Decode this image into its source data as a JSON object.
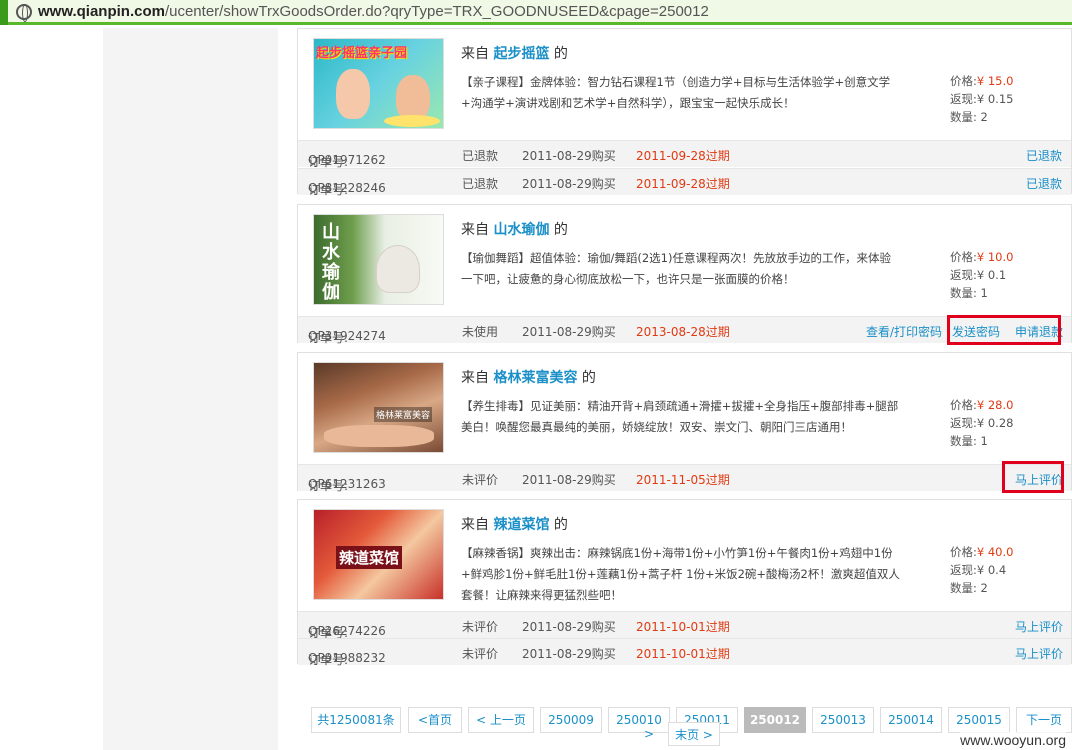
{
  "browser": {
    "url_domain": "www.qianpin.com",
    "url_path": "/ucenter/showTrxGoodsOrder.do?qryType=TRX_GOODNUSEED&cpage=250012"
  },
  "labels": {
    "from_prefix": "来自",
    "from_suffix": "的",
    "price": "价格:",
    "rebate": "返现:",
    "qty": "数量:",
    "order_no": "订单号:"
  },
  "orders": [
    {
      "shop": "起步摇篮",
      "thumb_text": "起步摇篮亲子园",
      "desc": "【亲子课程】金牌体验：智力钻石课程1节（创造力学+目标与生活体验学+创意文学+沟通学+演讲戏剧和艺术学+自然科学），跟宝宝一起快乐成长！",
      "price": "¥ 15.0",
      "rebate": "¥ 0.15",
      "qty": "2",
      "rows": [
        {
          "order_no": "QP91971262",
          "status": "已退款",
          "date": "2011-08-29购买",
          "expire": "2011-09-28过期",
          "actions": [
            "已退款"
          ]
        },
        {
          "order_no": "QP81228246",
          "status": "已退款",
          "date": "2011-08-29购买",
          "expire": "2011-09-28过期",
          "actions": [
            "已退款"
          ]
        }
      ]
    },
    {
      "shop": "山水瑜伽",
      "thumb_text": "山水瑜伽",
      "desc": "【瑜伽舞蹈】超值体验：瑜伽/舞蹈(2选1)任意课程两次！先放放手边的工作，来体验一下吧，让疲惫的身心彻底放松一下，也许只是一张面膜的价格！",
      "price": "¥ 10.0",
      "rebate": "¥ 0.1",
      "qty": "1",
      "rows": [
        {
          "order_no": "QP31924274",
          "status": "未使用",
          "date": "2011-08-29购买",
          "expire": "2013-08-28过期",
          "actions": [
            "查看/打印密码",
            "发送密码",
            "申请退款"
          ]
        }
      ]
    },
    {
      "shop": "格林莱富美容",
      "thumb_text": "格林莱富美容",
      "desc": "【养生排毒】见证美丽：精油开背+肩颈疏通+滑攉+拔攉+全身指压+腹部排毒+腿部美白！唤醒您最真最纯的美丽，娇娆绽放！双安、崇文门、朝阳门三店通用！",
      "price": "¥ 28.0",
      "rebate": "¥ 0.28",
      "qty": "1",
      "rows": [
        {
          "order_no": "QP61231263",
          "status": "未评价",
          "date": "2011-08-29购买",
          "expire": "2011-11-05过期",
          "actions": [
            "马上评价"
          ]
        }
      ]
    },
    {
      "shop": "辣道菜馆",
      "thumb_text": "辣道菜馆",
      "desc": "【麻辣香锅】爽辣出击：麻辣锅底1份+海带1份+小竹笋1份+午餐肉1份+鸡翅中1份+鲜鸡胗1份+鲜毛肚1份+莲藕1份+蒿子杆 1份+米饭2碗+酸梅汤2杯！激爽超值双人套餐！让麻辣来得更猛烈些吧！",
      "price": "¥ 40.0",
      "rebate": "¥ 0.4",
      "qty": "2",
      "rows": [
        {
          "order_no": "QP26274226",
          "status": "未评价",
          "date": "2011-08-29购买",
          "expire": "2011-10-01过期",
          "actions": [
            "马上评价"
          ]
        },
        {
          "order_no": "QP91988232",
          "status": "未评价",
          "date": "2011-08-29购买",
          "expire": "2011-10-01过期",
          "actions": [
            "马上评价"
          ]
        }
      ]
    }
  ],
  "pagination": {
    "total": "共1250081条",
    "first": "<首页",
    "prev": "< 上一页",
    "pages": [
      "250009",
      "250010",
      "250011",
      "250012",
      "250013",
      "250014",
      "250015"
    ],
    "current": "250012",
    "next": "下一页",
    "next_arrow": ">",
    "last": "末页 >"
  },
  "watermark": "www.wooyun.org",
  "colors": {
    "link": "#1a8fc8",
    "price_red": "#e03a12",
    "highlight_box": "#e0001b",
    "browser_green": "#58b82a"
  }
}
